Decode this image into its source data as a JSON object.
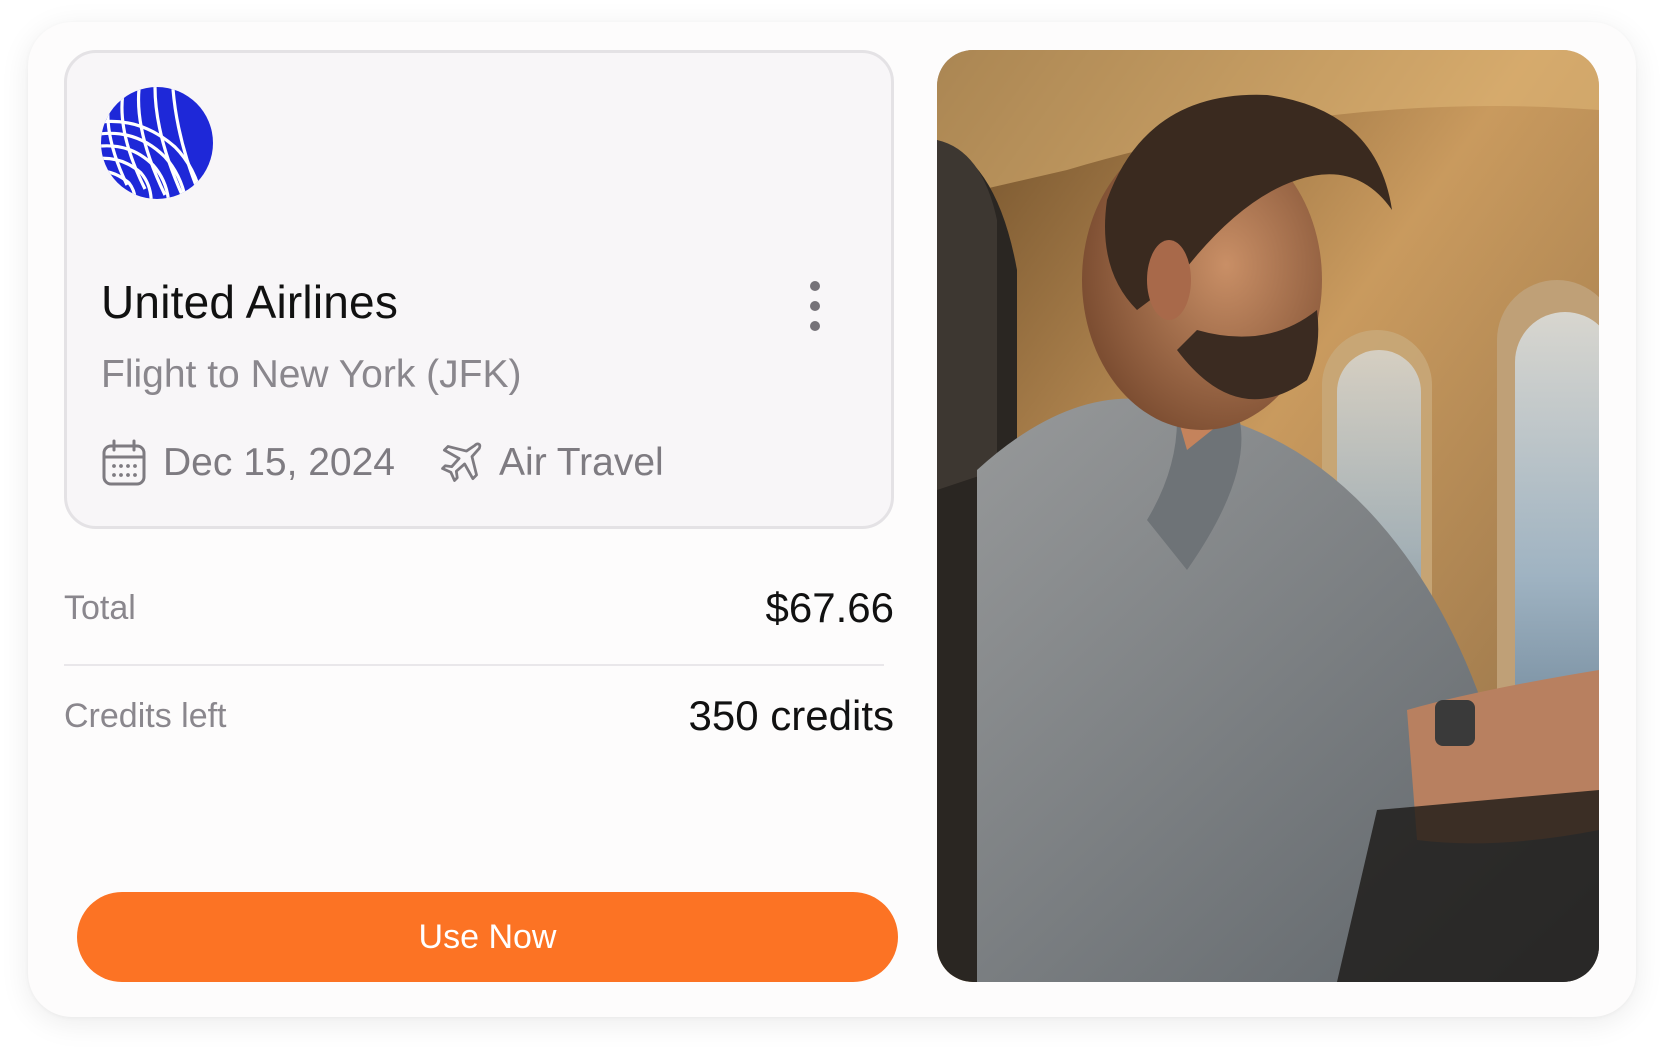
{
  "card": {
    "airline_name": "United Airlines",
    "flight_description": "Flight to New York (JFK)",
    "date": "Dec 15, 2024",
    "category": "Air Travel",
    "logo_icon": "globe-logo-icon",
    "more_icon": "more-vertical-icon",
    "date_icon": "calendar-icon",
    "category_icon": "airplane-icon"
  },
  "summary": {
    "total_label": "Total",
    "total_value": "$67.66",
    "credits_label": "Credits left",
    "credits_value": "350 credits"
  },
  "action": {
    "use_now_label": "Use Now"
  },
  "colors": {
    "accent": "#fc7324",
    "logo_blue": "#1e28d8"
  }
}
